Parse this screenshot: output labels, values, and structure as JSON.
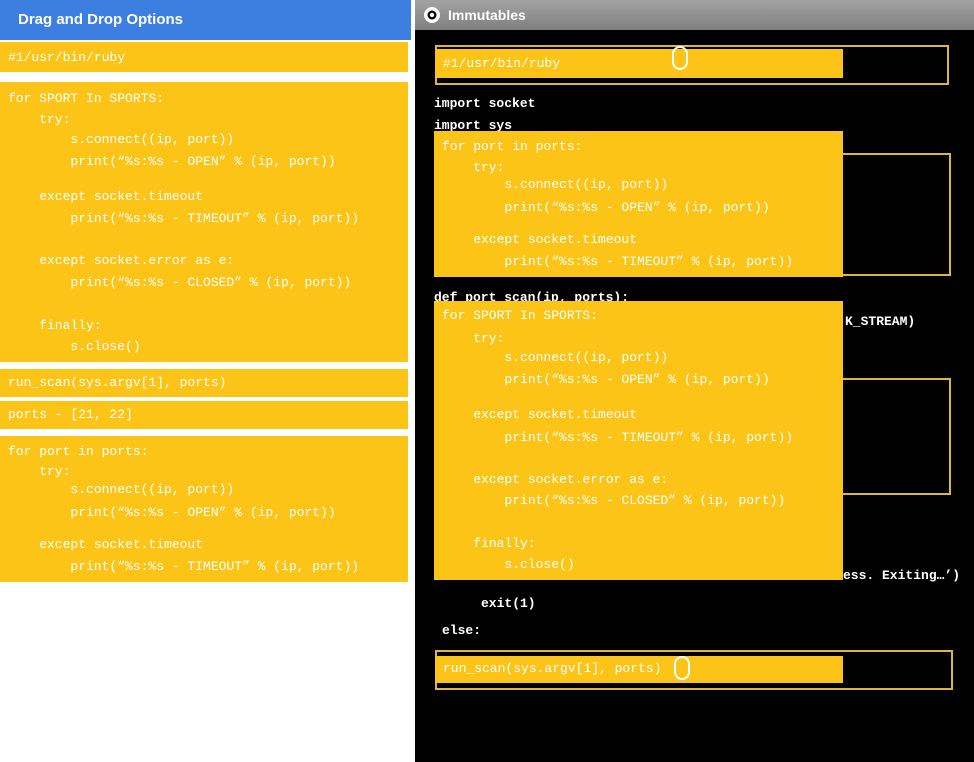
{
  "left_panel": {
    "title": "Drag and Drop Options",
    "options": [
      {
        "lines": [
          "#1/usr/bin/ruby"
        ]
      },
      {
        "lines": [
          "for SPORT In SPORTS:",
          "    try:",
          "        s.connect((ip, port))",
          "        print(“%s:%s - OPEN” % (ip, port))",
          "    except socket.timeout",
          "        print(“%s:%s - TIMEOUT” % (ip, port))",
          "    except socket.error as e:",
          "        print(“%s:%s - CLOSED” % (ip, port))",
          "    finally:",
          "        s.close()"
        ]
      },
      {
        "lines": [
          "run_scan(sys.argv[1], ports)"
        ]
      },
      {
        "lines": [
          "ports - [21, 22]"
        ]
      },
      {
        "lines": [
          "for port in ports:",
          "    try:",
          "        s.connect((ip, port))",
          "        print(“%s:%s - OPEN” % (ip, port))",
          "    except socket.timeout",
          "        print(“%s:%s - TIMEOUT” % (ip, port))"
        ]
      }
    ]
  },
  "right_panel": {
    "title": "Immutables",
    "icon": "gear-icon",
    "code": {
      "import_socket": "import socket",
      "import_sys": "import sys",
      "def_port_scan": "def port_scan(ip, ports):",
      "stream_fragment": "K_STREAM)",
      "exiting_fragment": "ess. Exiting…’)",
      "exit_call": "exit(1)",
      "else_kw": "else:"
    },
    "placed_blocks": [
      {
        "lines": [
          "#1/usr/bin/ruby"
        ]
      },
      {
        "lines": [
          "for port in ports:",
          "    try:",
          "        s.connect((ip, port))",
          "        print(“%s:%s - OPEN” % (ip, port))",
          "    except socket.timeout",
          "        print(“%s:%s - TIMEOUT” % (ip, port))"
        ]
      },
      {
        "lines": [
          "for SPORT In SPORTS:",
          "    try:",
          "        s.connect((ip, port))",
          "        print(“%s:%s - OPEN” % (ip, port))",
          "    except socket.timeout",
          "        print(“%s:%s - TIMEOUT” % (ip, port))",
          "    except socket.error as e:",
          "        print(“%s:%s - CLOSED” % (ip, port))",
          "    finally:",
          "        s.close()"
        ]
      },
      {
        "lines": [
          "run_scan(sys.argv[1], ports)"
        ]
      }
    ]
  },
  "colors": {
    "option_fill": "#fcc417",
    "header_blue": "#3d7fe1",
    "slot_border": "#ddb73a",
    "canvas_bg": "#000000"
  }
}
